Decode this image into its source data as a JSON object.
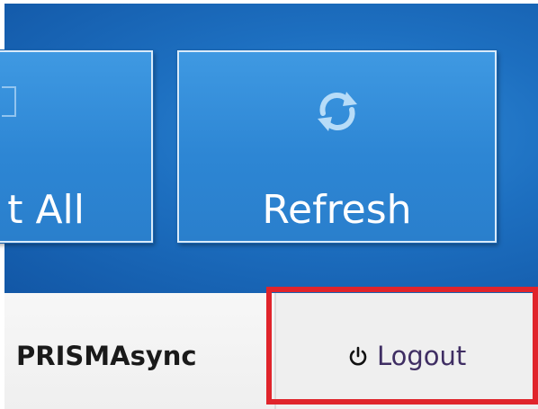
{
  "tiles": {
    "left_label": "t All",
    "refresh_label": "Refresh"
  },
  "bottom_bar": {
    "app_name": "PRISMAsync",
    "logout_label": "Logout"
  },
  "icons": {
    "refresh": "refresh-icon",
    "power": "power-icon"
  },
  "colors": {
    "background_blue": "#1d6fc0",
    "tile_blue": "#2d86d4",
    "highlight_red": "#e0242b",
    "logout_text": "#3f2e63"
  }
}
